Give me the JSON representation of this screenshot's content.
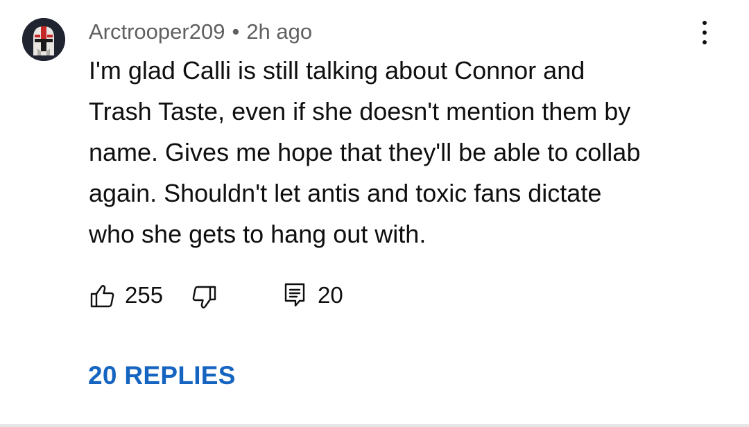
{
  "comment": {
    "author": "Arctrooper209",
    "separator": "•",
    "time": "2h ago",
    "text": "I'm glad Calli is still talking about Connor and\nTrash Taste, even if she doesn't mention them by\nname. Gives me hope that they'll be able to collab\nagain. Shouldn't let antis and toxic fans dictate\nwho she gets to hang out with.",
    "like_count": "255",
    "reply_count": "20",
    "replies_label": "20 REPLIES"
  },
  "icons": {
    "avatar": "clone-trooper-helmet-avatar",
    "more": "more-vertical-icon",
    "like": "thumbs-up-icon",
    "dislike": "thumbs-down-icon",
    "reply": "reply-comment-icon"
  },
  "colors": {
    "text": "#0f0f0f",
    "meta": "#606060",
    "link": "#1565c0",
    "divider": "#e5e5e5"
  }
}
